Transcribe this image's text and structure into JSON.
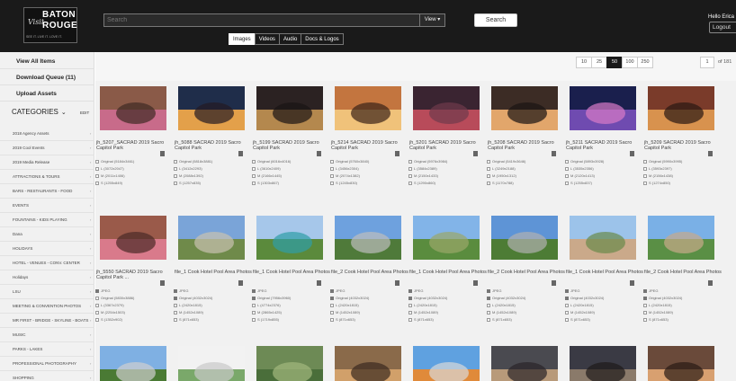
{
  "logo": {
    "script": "Visit",
    "line1": "BATON",
    "line2": "ROUGE",
    "tagline": "SEE IT. LIVE IT. LOVE IT."
  },
  "search": {
    "placeholder": "Search",
    "view_label": "View",
    "button_label": "Search"
  },
  "media_tabs": [
    {
      "label": "Images",
      "active": true
    },
    {
      "label": "Videos",
      "active": false
    },
    {
      "label": "Audio",
      "active": false
    },
    {
      "label": "Docs & Logos",
      "active": false
    }
  ],
  "user": {
    "greeting": "Hello Erica",
    "logout_label": "Logout"
  },
  "sidebar": {
    "links": [
      "View All Items",
      "Download Queue (11)",
      "Upload Assets"
    ],
    "categories_label": "CATEGORIES",
    "edit_label": "EDIT",
    "categories": [
      "2018 Agency Assets",
      "2019 Cool Events",
      "2019 Media Release",
      "ATTRACTIONS & TOURS",
      "BARS - RESTAURANTS - FOOD",
      "EVENTS",
      "FOUNTAINS - KIDS PLAYING",
      "Dana",
      "HOLIDAYS",
      "HOTEL - VENUES - CONV. CENTER",
      "Holidays",
      "LSU",
      "MEETING & CONVENTION PHOTOS",
      "MR FIRST - BRIDGE - SKYLINE - BOATS",
      "MUSIC",
      "PARKS - LAKES",
      "PROFESSIONAL PHOTOGRAPHY",
      "SHOPPING"
    ]
  },
  "pagination": {
    "sizes": [
      "10",
      "25",
      "50",
      "100",
      "250"
    ],
    "active_size": "50",
    "page": "1",
    "of_label": "of 181"
  },
  "cards_row1": [
    {
      "title": "jh_5207_SACRAD 2019 Sacro Capitol Park",
      "options": [
        "Original (5184x3461)",
        "L (3072x2047)",
        "M (2011x1406)",
        "S (1255x849)"
      ],
      "colors": [
        "#8a5a48",
        "#c86b8a",
        "#3e2a24"
      ]
    },
    {
      "title": "jh_5088 SACRAD 2019 Sacro Capitol Park",
      "options": [
        "Original (5818x3881)",
        "L (3412x2293)",
        "M (2088x1392)",
        "S (1257x835)"
      ],
      "colors": [
        "#1f2d4a",
        "#e3a04a",
        "#241a22"
      ]
    },
    {
      "title": "jh_5199 SACRAD 2019 Sacro Capitol Park",
      "options": [
        "Original (6016x4016)",
        "L (3610x2409)",
        "M (2166x1445)",
        "S (1303x867)"
      ],
      "colors": [
        "#2b2222",
        "#b4884e",
        "#1a1414"
      ]
    },
    {
      "title": "jh_5214 SACRAD 2019 Sacro Capitol Park",
      "options": [
        "Original (5760x3840)",
        "L (3456x2304)",
        "M (2074x1382)",
        "S (1245x830)"
      ],
      "colors": [
        "#c3753f",
        "#f0c27a",
        "#3a2218"
      ]
    },
    {
      "title": "jh_5201 SACRAD 2019 Sacro Capitol Park",
      "options": [
        "Original (5976x3984)",
        "L (3584x2389)",
        "M (2150x1433)",
        "S (1290x860)"
      ],
      "colors": [
        "#3a2431",
        "#b84b5a",
        "#6f3a4b"
      ]
    },
    {
      "title": "jh_5208 SACRAD 2019 Sacro Capitol Park",
      "options": [
        "Original (5419x3646)",
        "L (3249x2188)",
        "M (1950x1312)",
        "S (1170x788)"
      ],
      "colors": [
        "#3c2c25",
        "#e2a66b",
        "#1a1413"
      ]
    },
    {
      "title": "jh_5211 SACRAD 2019 Sacro Capitol Park",
      "options": [
        "Original (5893x3928)",
        "L (3535x2356)",
        "M (2120x1413)",
        "S (1255x837)"
      ],
      "colors": [
        "#1a1f4d",
        "#6f4bb0",
        "#d87ac7"
      ]
    },
    {
      "title": "jh_5209 SACRAD 2019 Sacro Capitol Park",
      "options": [
        "Original (5990x3995)",
        "L (3593x2397)",
        "M (2156x1438)",
        "S (1274x850)"
      ],
      "colors": [
        "#7a3b2a",
        "#d8924e",
        "#2a1812"
      ]
    }
  ],
  "cards_row2": [
    {
      "title": "jh_5550 SACRAD 2019 Sacro Capitol Park ...",
      "options": [
        "JPEG",
        "Original (5830x3886)",
        "L (3367x2379)",
        "M (2254x1503)",
        "S (1352x902)"
      ],
      "colors": [
        "#9a5a4a",
        "#d97a8b",
        "#4a2a26"
      ]
    },
    {
      "title": "file_1 Cook Hotel Pool Area Photos",
      "options": [
        "JPEG",
        "Original (4032x3024)",
        "L (2420x1815)",
        "M (1452x1089)",
        "S (871x653)"
      ],
      "colors": [
        "#7aa4d8",
        "#6f8a4a",
        "#c9c2b0"
      ]
    },
    {
      "title": "file_1 Cook Hotel Pool Area Photos",
      "options": [
        "JPEG",
        "Original (7956x3960)",
        "L (4774x2376)",
        "M (2865x1425)",
        "S (1719x855)"
      ],
      "colors": [
        "#a6c7ea",
        "#5b8a3c",
        "#2f9ea6"
      ]
    },
    {
      "title": "file_2 Cook Hotel Pool Area Photos",
      "options": [
        "JPEG",
        "Original (4032x3024)",
        "L (2420x1815)",
        "M (1452x1089)",
        "S (871x653)"
      ],
      "colors": [
        "#6ea1de",
        "#4f7a3a",
        "#bdbdbd"
      ]
    },
    {
      "title": "file_1 Cook Hotel Pool Area Photos",
      "options": [
        "JPEG",
        "Original (4032x3024)",
        "L (2420x1815)",
        "M (1452x1089)",
        "S (871x653)"
      ],
      "colors": [
        "#82b4e8",
        "#5a8c3e",
        "#9aa66a"
      ]
    },
    {
      "title": "file_2 Cook Hotel Pool Area Photos",
      "options": [
        "JPEG",
        "Original (4032x3024)",
        "L (2420x1815)",
        "M (1452x1089)",
        "S (871x653)"
      ],
      "colors": [
        "#5e94d6",
        "#4d7c35",
        "#b0b0b0"
      ]
    },
    {
      "title": "file_1 Cook Hotel Pool Area Photos",
      "options": [
        "JPEG",
        "Original (4032x3024)",
        "L (2420x1815)",
        "M (1452x1089)",
        "S (871x653)"
      ],
      "colors": [
        "#9cc3ea",
        "#caa98a",
        "#6a8a4a"
      ]
    },
    {
      "title": "file_2 Cook Hotel Pool Area Photos",
      "options": [
        "JPEG",
        "Original (4032x3024)",
        "L (2420x1815)",
        "M (1452x1089)",
        "S (871x653)"
      ],
      "colors": [
        "#7ab0e6",
        "#5a8f45",
        "#c7a98a"
      ]
    }
  ],
  "cards_row3": [
    {
      "colors": [
        "#7fb0e3",
        "#4a7a34",
        "#cfcfcf"
      ]
    },
    {
      "colors": [
        "#f2f2f2",
        "#7aa86a",
        "#c9c9c9"
      ]
    },
    {
      "colors": [
        "#6d8a55",
        "#4a6e3a",
        "#a3b87e"
      ]
    },
    {
      "colors": [
        "#8a6a4a",
        "#d1a06a",
        "#3a2a20"
      ]
    },
    {
      "colors": [
        "#5fa1e0",
        "#e08a3a",
        "#d8d8d8"
      ]
    },
    {
      "colors": [
        "#4a4a50",
        "#b89a7a",
        "#2a2428"
      ]
    },
    {
      "colors": [
        "#3a3a44",
        "#8a7a6a",
        "#1e1a1a"
      ]
    },
    {
      "colors": [
        "#6a4a3a",
        "#d8a070",
        "#2a1a14"
      ]
    }
  ]
}
